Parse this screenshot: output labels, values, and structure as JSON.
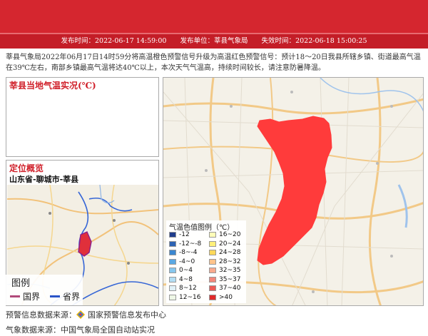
{
  "info_bar": {
    "publish_time_label": "发布时间：",
    "publish_time": "2022-06-17 14:59:00",
    "publisher_label": "发布单位：",
    "publisher": "莘县气象局",
    "expire_label": "失效时间：",
    "expire_time": "2022-06-18 15:00:25"
  },
  "summary": "莘县气象局2022年06月17日14时59分将高温橙色预警信号升级为高温红色预警信号：预计18～20日我县所辖乡镇、街道最高气温在39℃左右，南部乡镇最高气温将达40℃以上，本次天气气温高，持续时间较长，请注意防暑降温。",
  "temp_panel": {
    "title": "莘县当地气温实况(℃)"
  },
  "locate_panel": {
    "title": "定位概览",
    "location": "山东省-聊城市-莘县",
    "legend_title": "图例",
    "legend_country": "国界",
    "legend_province": "省界"
  },
  "map_legend": {
    "title": "气温色值图例（℃）",
    "items": [
      {
        "label": "-12",
        "color": "#1f3d8c"
      },
      {
        "label": "16~20",
        "color": "#fffdb8"
      },
      {
        "label": "-12~-8",
        "color": "#2d63b3"
      },
      {
        "label": "20~24",
        "color": "#fff07a"
      },
      {
        "label": "-8~-4",
        "color": "#3b87d0"
      },
      {
        "label": "24~28",
        "color": "#ffd85a"
      },
      {
        "label": "-4~0",
        "color": "#5aa8e3"
      },
      {
        "label": "28~32",
        "color": "#ffc38a"
      },
      {
        "label": "0~4",
        "color": "#86c7ee"
      },
      {
        "label": "32~35",
        "color": "#f9a98c"
      },
      {
        "label": "4~8",
        "color": "#b3def4"
      },
      {
        "label": "35~37",
        "color": "#f3877a"
      },
      {
        "label": "8~12",
        "color": "#e0f1f8"
      },
      {
        "label": "37~40",
        "color": "#ec5a55"
      },
      {
        "label": "12~16",
        "color": "#eef7e6"
      },
      {
        "label": ">40",
        "color": "#e02a2a"
      }
    ]
  },
  "footer": {
    "warning_source_label": "预警信息数据来源：",
    "warning_source": "国家预警信息发布中心",
    "weather_source_label": "气象数据来源：",
    "weather_source": "中国气象局全国自动站实况"
  },
  "colors": {
    "banner": "#d5262f",
    "warning_area": "#ff3b3b",
    "title_red": "#d0202a"
  }
}
